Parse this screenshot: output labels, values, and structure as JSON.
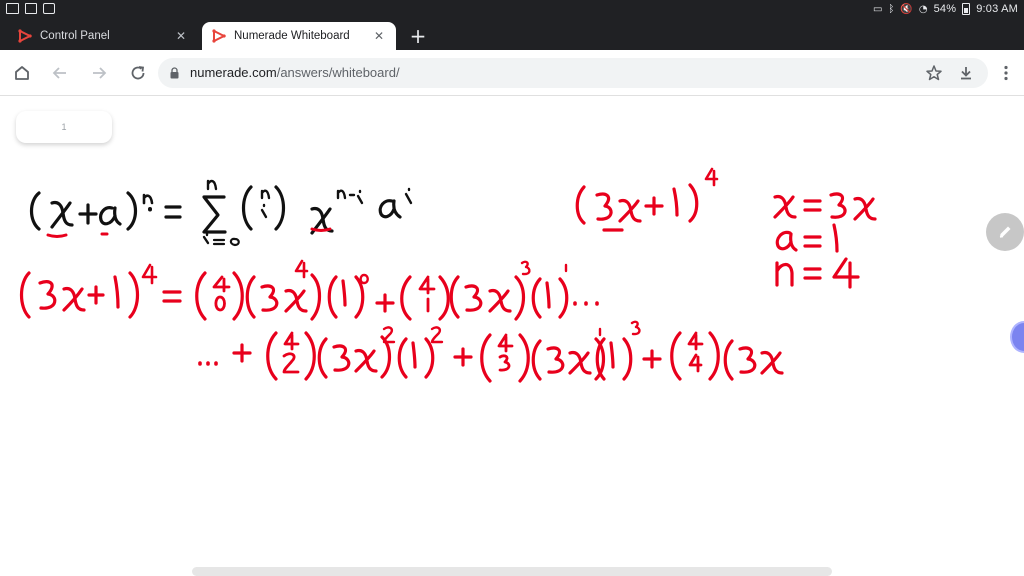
{
  "status_bar": {
    "battery": "54%",
    "time": "9:03 AM"
  },
  "tabs": [
    {
      "title": "Control Panel",
      "active": false
    },
    {
      "title": "Numerade Whiteboard",
      "active": true
    }
  ],
  "toolbar": {
    "url_host": "numerade.com",
    "url_path": "/answers/whiteboard/"
  },
  "page": {
    "page_number": "1"
  },
  "colors": {
    "ink_black": "#111111",
    "ink_red": "#e8001c",
    "chrome_dark": "#202124",
    "favicon_red": "#e8453c"
  },
  "icons": {
    "home": "home-icon",
    "back": "back-arrow-icon",
    "forward": "forward-arrow-icon",
    "reload": "reload-icon",
    "star": "bookmark-star-icon",
    "download": "download-icon",
    "menu": "more-vert-icon",
    "pencil": "pencil-icon"
  }
}
